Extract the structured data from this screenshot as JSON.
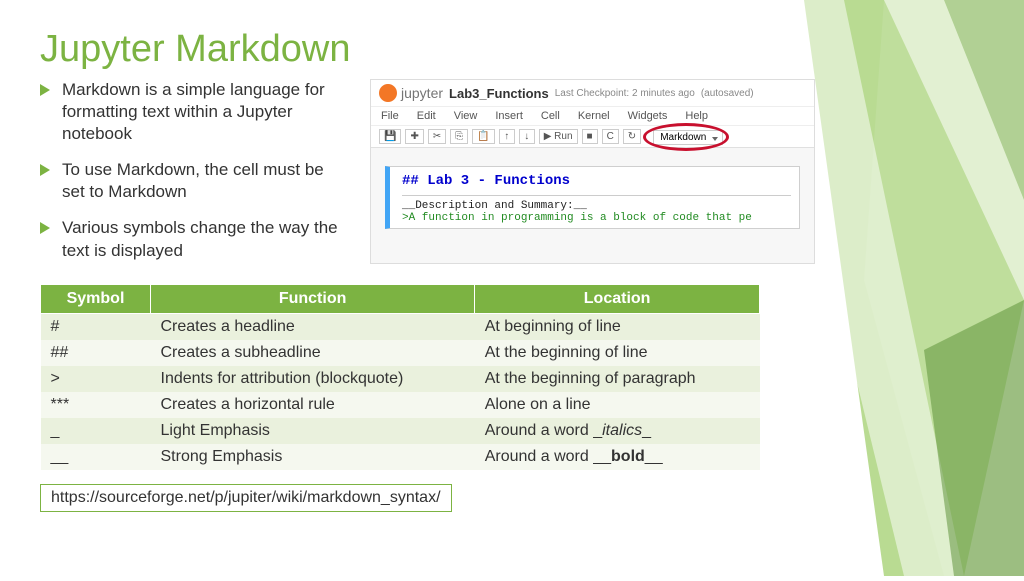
{
  "title": "Jupyter Markdown",
  "bullets": [
    "Markdown is a simple language for formatting text within a Jupyter notebook",
    "To use Markdown, the cell must be set to Markdown",
    "Various symbols change the way the text is displayed"
  ],
  "jupyter": {
    "brand": "jupyter",
    "nbTitle": "Lab3_Functions",
    "checkpoint": "Last Checkpoint: 2 minutes ago",
    "autosaved": "(autosaved)",
    "menus": [
      "File",
      "Edit",
      "View",
      "Insert",
      "Cell",
      "Kernel",
      "Widgets",
      "Help"
    ],
    "toolbar": [
      "💾",
      "✚",
      "✂",
      "⎘",
      "📋",
      "↑",
      "↓",
      "▶ Run",
      "■",
      "C",
      "↻"
    ],
    "dropdown": "Markdown",
    "cell": {
      "heading": "## Lab 3 - Functions",
      "desc": "__Description and Summary:__",
      "quote": ">A function in programming is a block of code that pe"
    }
  },
  "table": {
    "headers": [
      "Symbol",
      "Function",
      "Location"
    ],
    "rows": [
      {
        "sym": "#",
        "fn": "Creates a headline",
        "loc": "At beginning of line"
      },
      {
        "sym": "##",
        "fn": "Creates a subheadline",
        "loc": "At the beginning of line"
      },
      {
        "sym": ">",
        "fn": "Indents for attribution (blockquote)",
        "loc": "At the beginning of paragraph"
      },
      {
        "sym": "***",
        "fn": "Creates a horizontal rule",
        "loc": "Alone on a line"
      },
      {
        "sym": "_",
        "fn": "Light Emphasis",
        "loc_pre": "Around a word _",
        "loc_mid": "italics",
        "loc_post": "_",
        "style": "ital"
      },
      {
        "sym": "__",
        "fn": "Strong Emphasis",
        "loc_pre": "Around a word __",
        "loc_mid": "bold",
        "loc_post": "__",
        "style": "bold"
      }
    ]
  },
  "link": "https://sourceforge.net/p/jupiter/wiki/markdown_syntax/"
}
